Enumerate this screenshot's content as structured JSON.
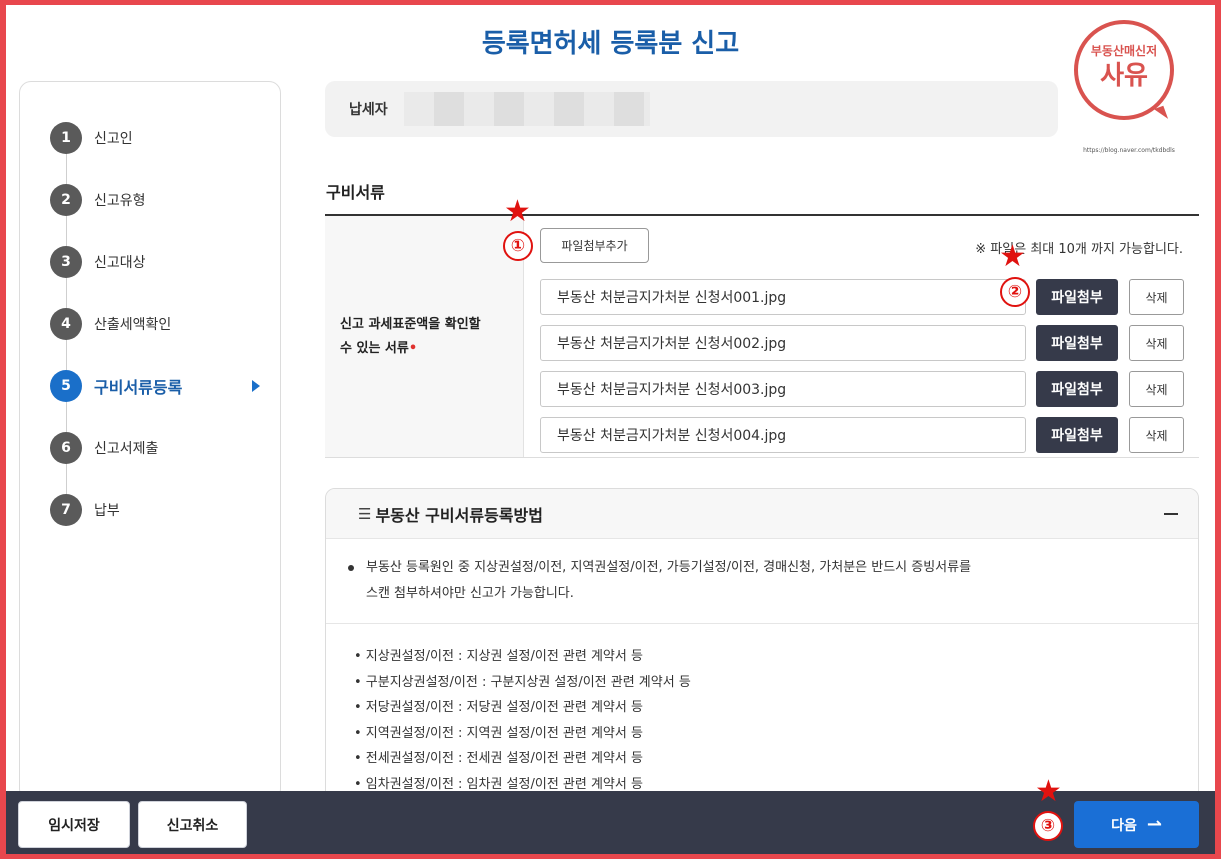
{
  "page": {
    "title": "등록면허세 등록분 신고"
  },
  "logo": {
    "top": "부동산매신저",
    "main": "사유",
    "url": "https://blog.naver.com/tkdbdls"
  },
  "sidebar": {
    "steps": [
      {
        "num": "1",
        "label": "신고인"
      },
      {
        "num": "2",
        "label": "신고유형"
      },
      {
        "num": "3",
        "label": "신고대상"
      },
      {
        "num": "4",
        "label": "산출세액확인"
      },
      {
        "num": "5",
        "label": "구비서류등록"
      },
      {
        "num": "6",
        "label": "신고서제출"
      },
      {
        "num": "7",
        "label": "납부"
      }
    ]
  },
  "payer": {
    "label": "납세자"
  },
  "documents": {
    "section_title": "구비서류",
    "row_label_line1": "신고 과세표준액을 확인할",
    "row_label_line2": "수 있는 서류",
    "required_mark": "•",
    "add_button": "파일첨부추가",
    "notice": "※ 파일은 최대 10개 까지 가능합니다.",
    "attach_label": "파일첨부",
    "delete_label": "삭제",
    "files": [
      "부동산 처분금지가처분 신청서001.jpg",
      "부동산 처분금지가처분 신청서002.jpg",
      "부동산 처분금지가처분 신청서003.jpg",
      "부동산 처분금지가처분 신청서004.jpg"
    ]
  },
  "guide": {
    "title": "부동산 구비서류등록방법",
    "intro_line1": "부동산 등록원인 중 지상권설정/이전, 지역권설정/이전, 가등기설정/이전, 경매신청, 가처분은 반드시 증빙서류를",
    "intro_line2": "스캔 첨부하셔야만 신고가 가능합니다.",
    "items": [
      "• 지상권설정/이전 : 지상권 설정/이전 관련 계약서 등",
      "• 구분지상권설정/이전 : 구분지상권 설정/이전 관련 계약서 등",
      "• 저당권설정/이전 : 저당권 설정/이전 관련 계약서 등",
      "• 지역권설정/이전 : 지역권 설정/이전 관련 계약서 등",
      "• 전세권설정/이전 : 전세권 설정/이전 관련 계약서 등",
      "• 임차권설정/이전 : 임차권 설정/이전 관련 계약서 등"
    ]
  },
  "footer": {
    "save": "임시저장",
    "cancel": "신고취소",
    "next": "다음",
    "next_arrow": "⇀"
  },
  "annotations": {
    "c1": "①",
    "c2": "②",
    "c3": "③",
    "star": "★"
  },
  "colors": {
    "accent": "#1a6fc9",
    "dark": "#363a4a",
    "annotation": "#e0120f"
  }
}
